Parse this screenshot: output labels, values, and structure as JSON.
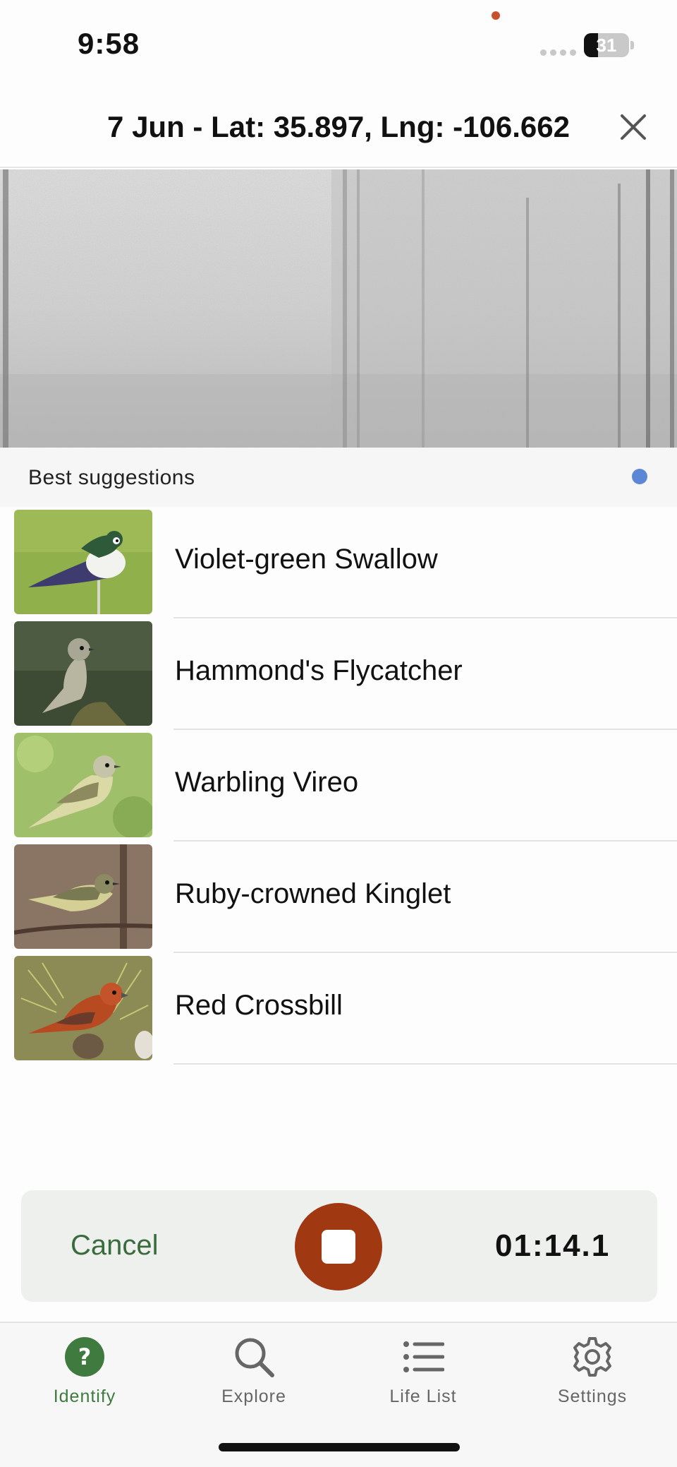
{
  "status_bar": {
    "time": "9:58",
    "battery": "31",
    "battery_level": 0.31,
    "recording_indicator_color": "#c9502d"
  },
  "header": {
    "title": "7 Jun - Lat: 35.897, Lng: -106.662",
    "close_icon": "close-icon"
  },
  "suggestions": {
    "section_title": "Best suggestions",
    "status_dot_color": "#5b87d6",
    "items": [
      {
        "name": "Violet-green Swallow",
        "thumbnail": "bird-photo"
      },
      {
        "name": "Hammond's Flycatcher",
        "thumbnail": "bird-photo"
      },
      {
        "name": "Warbling Vireo",
        "thumbnail": "bird-photo"
      },
      {
        "name": "Ruby-crowned Kinglet",
        "thumbnail": "bird-photo"
      },
      {
        "name": "Red Crossbill",
        "thumbnail": "bird-photo"
      }
    ]
  },
  "recorder": {
    "cancel_label": "Cancel",
    "elapsed": "01:14.1",
    "stop_icon": "stop-icon",
    "stop_color": "#a03812"
  },
  "tabs": [
    {
      "label": "Identify",
      "icon": "question-circle-icon",
      "active": true
    },
    {
      "label": "Explore",
      "icon": "search-icon",
      "active": false
    },
    {
      "label": "Life List",
      "icon": "list-icon",
      "active": false
    },
    {
      "label": "Settings",
      "icon": "gear-icon",
      "active": false
    }
  ],
  "colors": {
    "accent_green": "#3f7a3f",
    "recording_red": "#a03812"
  }
}
